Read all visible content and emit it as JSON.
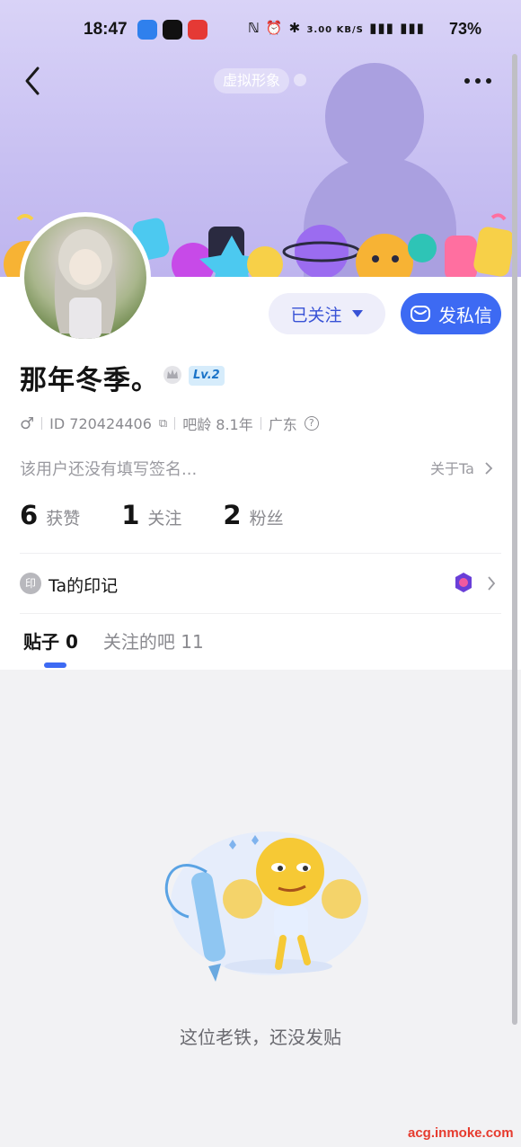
{
  "status_bar": {
    "time": "18:47",
    "network_speed": "3.00 KB/S",
    "battery": "73%"
  },
  "header": {
    "avatar_tag": "虚拟形象"
  },
  "profile": {
    "username": "那年冬季。",
    "level": "Lv.2",
    "id_text": "ID 720424406",
    "bar_age": "吧龄 8.1年",
    "location": "广东",
    "signature": "该用户还没有填写签名...",
    "about_label": "关于Ta",
    "follow_label": "已关注",
    "dm_label": "发私信"
  },
  "stats": [
    {
      "num": "6",
      "label": "获赞"
    },
    {
      "num": "1",
      "label": "关注"
    },
    {
      "num": "2",
      "label": "粉丝"
    }
  ],
  "seal": {
    "icon_text": "印",
    "label": "Ta的印记"
  },
  "tabs": [
    {
      "label": "贴子 0"
    },
    {
      "label": "关注的吧 11"
    }
  ],
  "empty_state": {
    "text": "这位老铁，还没发贴"
  },
  "watermark": "acg.inmoke.com",
  "colors": {
    "accent": "#3d6af3",
    "banner": "#c8c0f2",
    "follow_text": "#3852d6"
  }
}
